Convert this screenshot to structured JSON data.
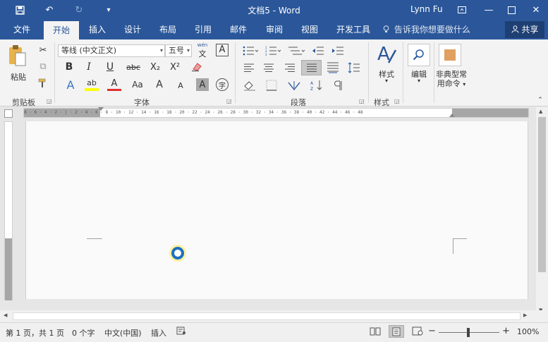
{
  "titlebar": {
    "title": "文档5 - Word",
    "user": "Lynn Fu",
    "icons": [
      "save-icon",
      "undo-icon",
      "redo-icon",
      "customize-qat-icon",
      "ribbon-display-icon",
      "minimize-icon",
      "maximize-icon",
      "close-icon"
    ],
    "glyphs": {
      "save": "💾",
      "undo": "↶",
      "redo": "↻",
      "customize": "▾",
      "ribbon": "⧉",
      "minimize": "—",
      "maximize": "☐",
      "close": "✕"
    }
  },
  "tabs": [
    "文件",
    "开始",
    "插入",
    "设计",
    "布局",
    "引用",
    "邮件",
    "审阅",
    "视图",
    "开发工具"
  ],
  "active_tab": "开始",
  "tell_me": "告诉我你想要做什么",
  "share": "共享",
  "ribbon": {
    "clipboard": {
      "label": "剪贴板",
      "paste": "粘贴"
    },
    "font": {
      "label": "字体",
      "font_name": "等线 (中文正文)",
      "font_size": "五号",
      "wen": "wén",
      "wen_char": "文",
      "A_box": "A",
      "bold": "B",
      "italic": "I",
      "underline": "U",
      "strike": "abc",
      "subscript": "X₂",
      "superscript": "X²",
      "text_effects": "A",
      "highlight": "ab",
      "font_color": "A",
      "change_case": "Aa",
      "grow": "A",
      "shrink": "A",
      "char_shading": "A",
      "enclose": "字"
    },
    "paragraph": {
      "label": "段落"
    },
    "styles": {
      "label": "样式",
      "button": "样式"
    },
    "editing": {
      "button": "编辑"
    },
    "custom": {
      "button_line1": "非典型常",
      "button_line2": "用命令"
    }
  },
  "ruler_ticks": "8 · 6 · 4 · 2 · | · 2 · 4 · 6 · 8 · 10 · 12 · 14 · 16 · 18 · 20 · 22 · 24 · 26 · 28 · 30 · 32 · 34 · 36 · 38 · 40 · 42 · 44 · 46 · 48",
  "statusbar": {
    "page": "第 1 页，共 1 页",
    "words": "0 个字",
    "language": "中文(中国)",
    "mode": "插入",
    "zoom": "100%",
    "zoom_minus": "−",
    "zoom_plus": "+"
  },
  "colors": {
    "accent": "#2b579a",
    "highlight_yellow": "#ffff00",
    "font_red": "#e03030",
    "cursor_ring": "#1e6fbf"
  }
}
